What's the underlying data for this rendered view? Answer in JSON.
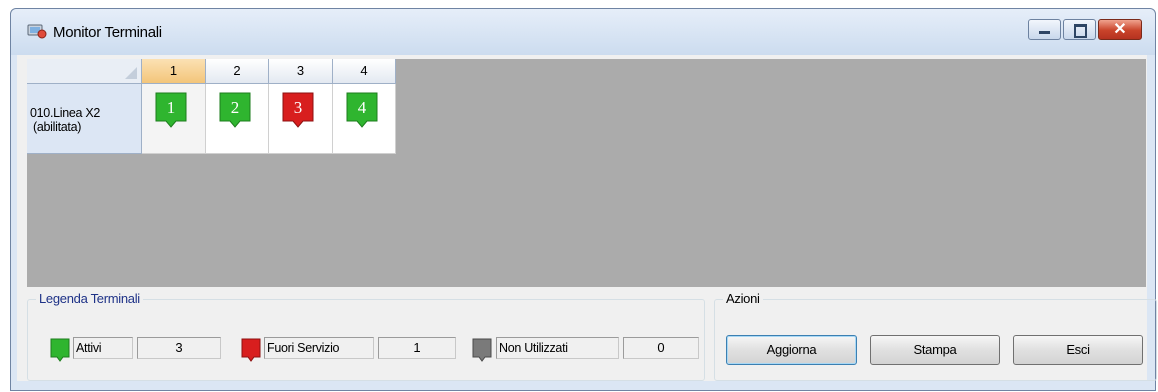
{
  "window": {
    "title": "Monitor Terminali"
  },
  "grid": {
    "columns": [
      "1",
      "2",
      "3",
      "4"
    ],
    "selected_column": "1",
    "rows": [
      {
        "label_line1": "010.Linea X2",
        "label_line2": "(abilitata)",
        "terminals": [
          {
            "number": "1",
            "status": "Attivi"
          },
          {
            "number": "2",
            "status": "Attivi"
          },
          {
            "number": "3",
            "status": "Fuori Servizio"
          },
          {
            "number": "4",
            "status": "Attivi"
          }
        ]
      }
    ]
  },
  "legend": {
    "title": "Legenda Terminali",
    "items": [
      {
        "label": "Attivi",
        "count": "3",
        "color": "#2fb52f",
        "icon": "terminal-active-icon"
      },
      {
        "label": "Fuori Servizio",
        "count": "1",
        "color": "#d81e1e",
        "icon": "terminal-out-of-service-icon"
      },
      {
        "label": "Non Utilizzati",
        "count": "0",
        "color": "#7a7a7a",
        "icon": "terminal-unused-icon"
      }
    ]
  },
  "actions": {
    "title": "Azioni",
    "buttons": [
      "Aggiorna",
      "Stampa",
      "Esci"
    ]
  },
  "colors": {
    "active": "#2fb52f",
    "out_of_service": "#d81e1e",
    "unused": "#7a7a7a",
    "grid_bg": "#ababab"
  }
}
